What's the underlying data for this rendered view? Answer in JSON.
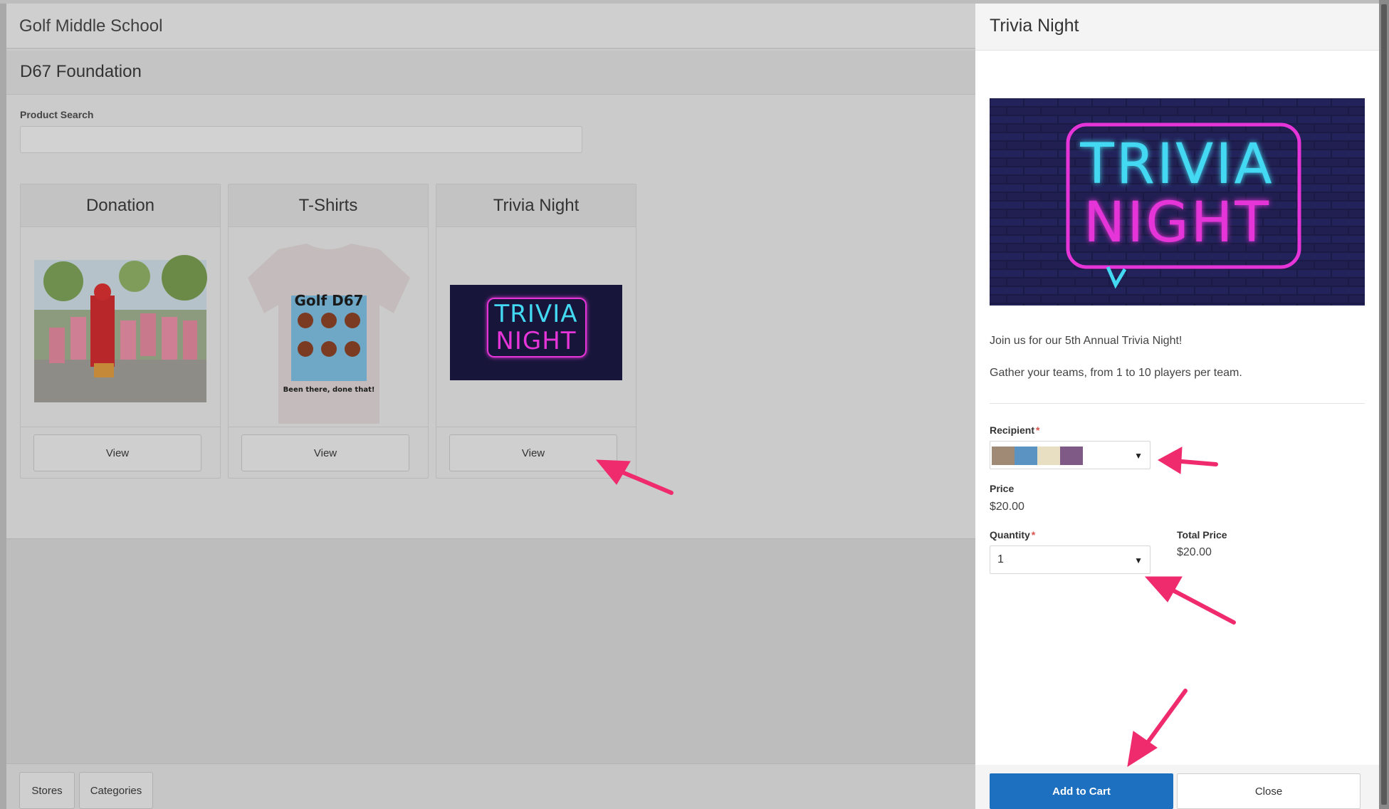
{
  "header": {
    "school_name": "Golf Middle School",
    "store_name": "D67 Foundation"
  },
  "search": {
    "label": "Product Search",
    "value": "",
    "placeholder": ""
  },
  "products": [
    {
      "title": "Donation",
      "button_label": "View"
    },
    {
      "title": "T-Shirts",
      "button_label": "View",
      "shirt_text": [
        "Golf D67",
        "Been there, done that!"
      ]
    },
    {
      "title": "Trivia Night",
      "button_label": "View",
      "image_text": [
        "TRIVIA",
        "NIGHT"
      ]
    }
  ],
  "bottom_nav": {
    "stores_label": "Stores",
    "categories_label": "Categories"
  },
  "panel": {
    "title": "Trivia Night",
    "image_text": [
      "TRIVIA",
      "NIGHT"
    ],
    "description_1": "Join us for our 5th Annual Trivia Night!",
    "description_2": "Gather your teams, from 1 to 10 players per team.",
    "recipient_label": "Recipient",
    "required_mark": "*",
    "recipient_swatches": [
      "#a08a76",
      "#5b93c2",
      "#e8dfc2",
      "#7f5a86"
    ],
    "price_label": "Price",
    "price_value": "$20.00",
    "quantity_label": "Quantity",
    "quantity_value": "1",
    "total_price_label": "Total Price",
    "total_price_value": "$20.00",
    "add_to_cart_label": "Add to Cart",
    "close_label": "Close"
  },
  "colors": {
    "accent_blue": "#1d6fbf",
    "annotation_arrow": "#ef2b6e",
    "neon_cyan": "#44d9f2",
    "neon_magenta": "#e535d8"
  }
}
